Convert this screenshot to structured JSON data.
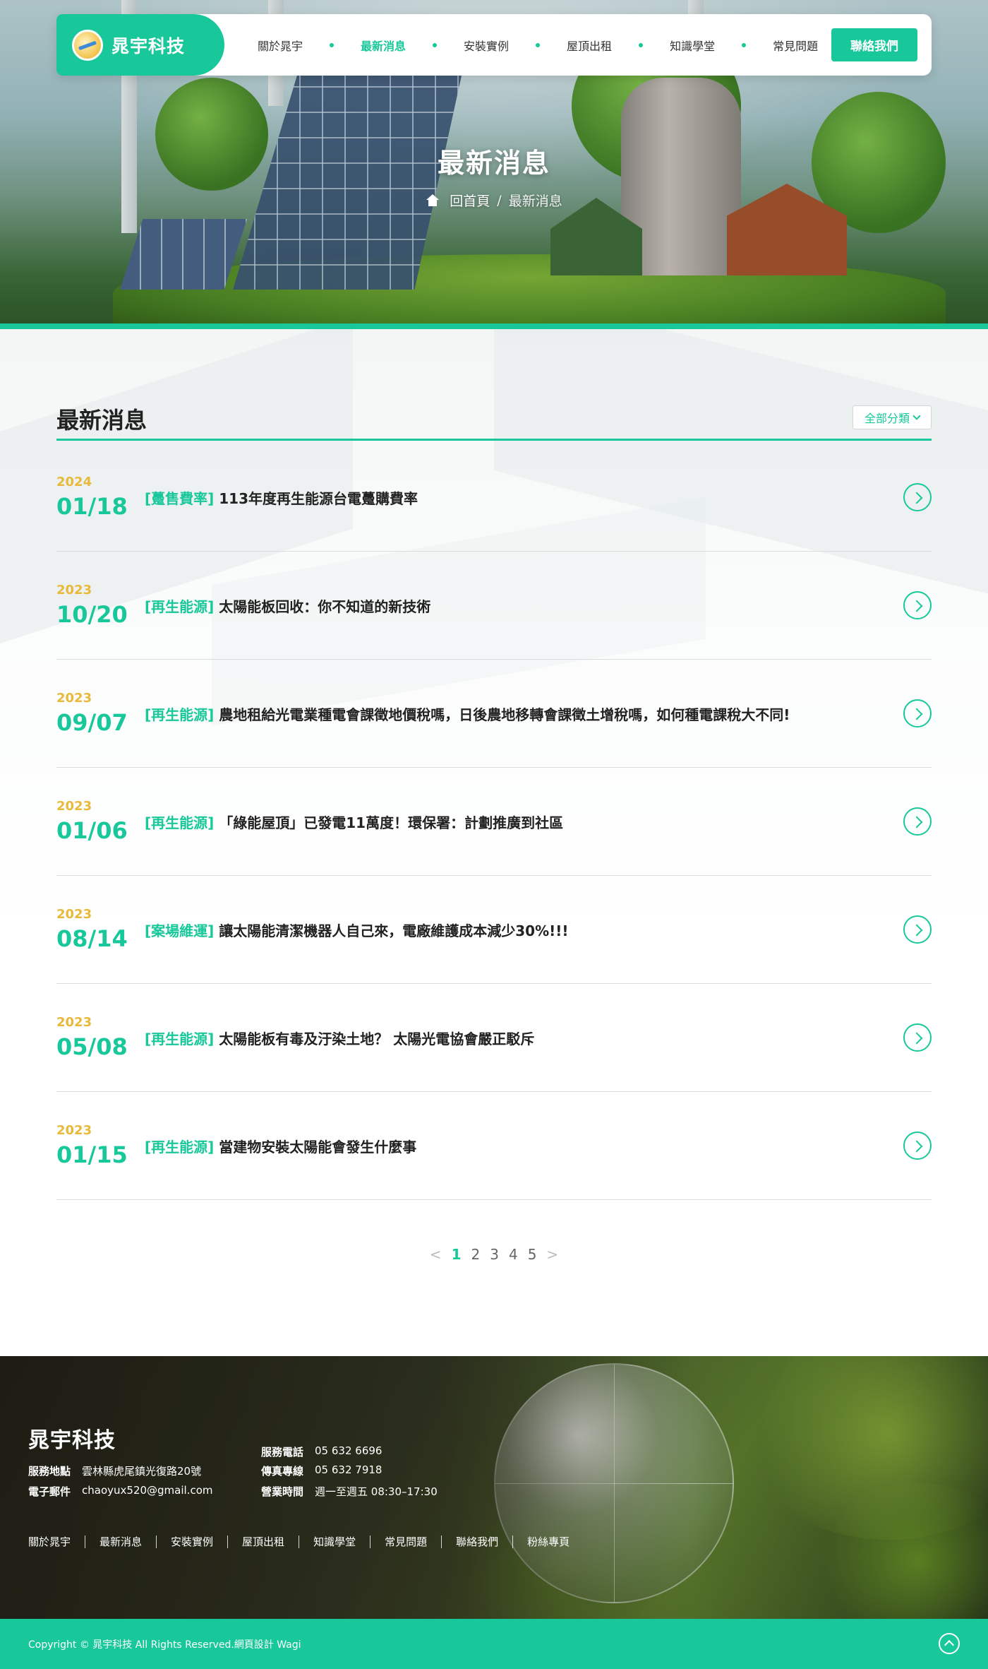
{
  "brand": {
    "name": "晁宇科技"
  },
  "nav": {
    "items": [
      {
        "label": "關於晁宇",
        "active": false
      },
      {
        "label": "最新消息",
        "active": true
      },
      {
        "label": "安裝實例",
        "active": false
      },
      {
        "label": "屋頂出租",
        "active": false
      },
      {
        "label": "知識學堂",
        "active": false
      },
      {
        "label": "常見問題",
        "active": false
      }
    ],
    "cta": "聯絡我們"
  },
  "hero": {
    "title": "最新消息",
    "breadcrumb": {
      "home": "回首頁",
      "separator": "/",
      "current": "最新消息"
    }
  },
  "news": {
    "heading": "最新消息",
    "filter": "全部分類",
    "items": [
      {
        "year": "2024",
        "date": "01/18",
        "category": "[躉售費率]",
        "title": "113年度再生能源台電躉購費率"
      },
      {
        "year": "2023",
        "date": "10/20",
        "category": "[再生能源]",
        "title": "太陽能板回收：你不知道的新技術"
      },
      {
        "year": "2023",
        "date": "09/07",
        "category": "[再生能源]",
        "title": "農地租給光電業種電會課徵地價稅嗎，日後農地移轉會課徵土增稅嗎，如何種電課稅大不同!"
      },
      {
        "year": "2023",
        "date": "01/06",
        "category": "[再生能源]",
        "title": "「綠能屋頂」已發電11萬度！環保署：計劃推廣到社區"
      },
      {
        "year": "2023",
        "date": "08/14",
        "category": "[案場維運]",
        "title": "讓太陽能清潔機器人自己來，電廠維護成本減少30%!!!"
      },
      {
        "year": "2023",
        "date": "05/08",
        "category": "[再生能源]",
        "title": "太陽能板有毒及汙染土地？ 太陽光電協會嚴正駁斥"
      },
      {
        "year": "2023",
        "date": "01/15",
        "category": "[再生能源]",
        "title": "當建物安裝太陽能會發生什麼事"
      }
    ]
  },
  "pagination": {
    "prev": "<",
    "next": ">",
    "pages": [
      "1",
      "2",
      "3",
      "4",
      "5"
    ],
    "current": "1"
  },
  "footer": {
    "brand": "晁宇科技",
    "address_label": "服務地點",
    "address": "雲林縣虎尾鎮光復路20號",
    "email_label": "電子郵件",
    "email": "chaoyux520@gmail.com",
    "phone_label": "服務電話",
    "phone": "05 632 6696",
    "fax_label": "傳真專線",
    "fax": "05 632 7918",
    "hours_label": "營業時間",
    "hours": "週一至週五 08:30–17:30",
    "links": [
      "關於晁宇",
      "最新消息",
      "安裝實例",
      "屋頂出租",
      "知識學堂",
      "常見問題",
      "聯絡我們",
      "粉絲專頁"
    ],
    "copyright": "Copyright © 晁宇科技 All Rights Reserved.網頁設計 Wagi"
  },
  "colors": {
    "accent": "#19c89a",
    "year": "#e8b93a",
    "text": "#222222"
  },
  "icons": {
    "home": "home-icon",
    "arrow": "chevron-right-circle-icon",
    "top": "arrow-up-circle-icon"
  }
}
